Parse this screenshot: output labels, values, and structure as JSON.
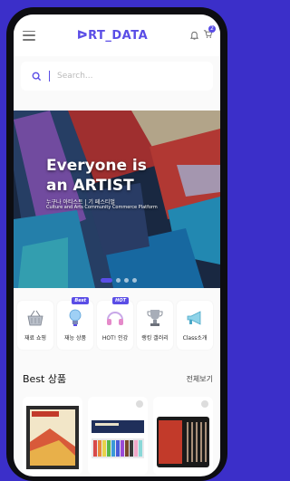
{
  "header": {
    "logo": "ᐅRT_DATA",
    "cart_count": "2"
  },
  "search": {
    "placeholder": "Search..."
  },
  "banner": {
    "headline_line1": "Everyone is",
    "headline_line2": "an ARTIST",
    "sub_korean": "누구나 아티스트 | 기 페스티벌",
    "sub_english": "Culture and Arts Community Commerce Platform",
    "slide_count": 4,
    "active_slide": 1
  },
  "categories": [
    {
      "label": "재료 쇼핑",
      "icon": "shopping-basket-icon",
      "tag": ""
    },
    {
      "label": "재능 상품",
      "icon": "lightbulb-icon",
      "tag": "Best"
    },
    {
      "label": "HOT! 인강",
      "icon": "headphones-icon",
      "tag": "HOT"
    },
    {
      "label": "랭킹 갤러리",
      "icon": "trophy-icon",
      "tag": ""
    },
    {
      "label": "Class소개",
      "icon": "megaphone-icon",
      "tag": ""
    }
  ],
  "best": {
    "title": "Best 상품",
    "more_label": "전체보기",
    "products": [
      {
        "name": "canvas-pad-product"
      },
      {
        "name": "paint-set-product"
      },
      {
        "name": "brush-case-product"
      }
    ]
  },
  "colors": {
    "accent": "#5a4de6",
    "background": "#3b2fc9"
  }
}
